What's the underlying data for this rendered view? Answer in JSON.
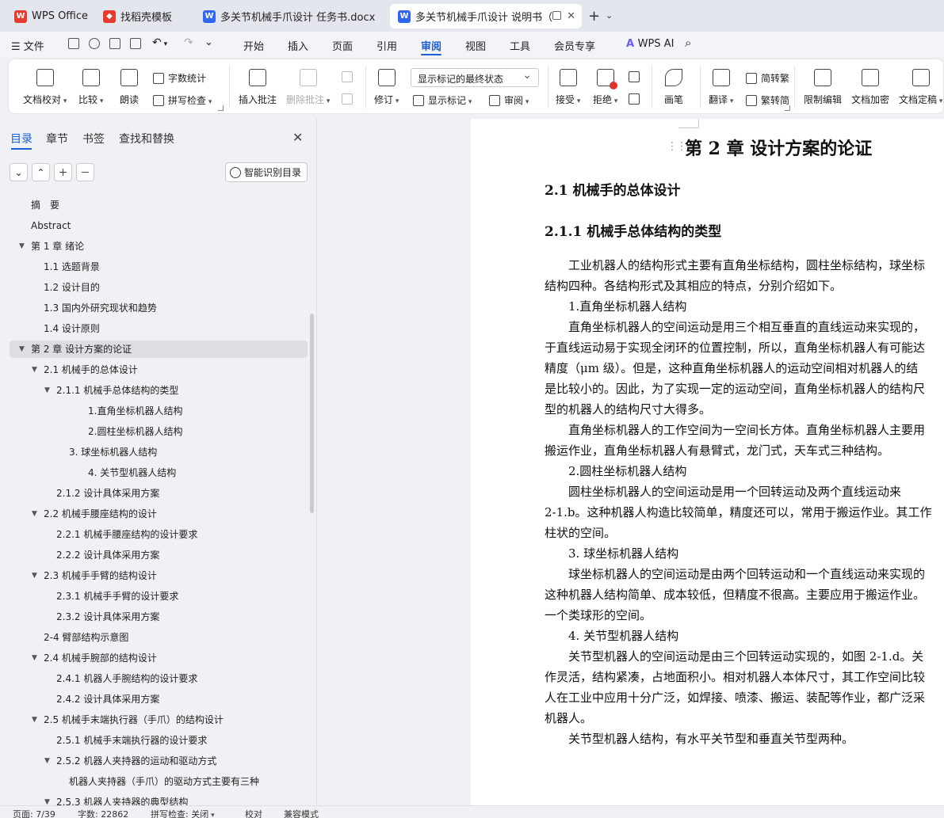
{
  "tabs": [
    {
      "label": "WPS Office",
      "icon": "wps-logo-icon",
      "color": "#e63a2e"
    },
    {
      "label": "找稻壳模板",
      "icon": "docer-icon",
      "color": "#e63a2e"
    },
    {
      "label": "多关节机械手爪设计 任务书.docx",
      "icon": "word-doc-icon",
      "color": "#2f67f2"
    },
    {
      "label": "多关节机械手爪设计 说明书（",
      "icon": "word-doc-icon",
      "color": "#2f67f2"
    }
  ],
  "menu": {
    "file": "文件",
    "items": [
      "开始",
      "插入",
      "页面",
      "引用",
      "审阅",
      "视图",
      "工具",
      "会员专享"
    ],
    "active": "审阅",
    "ai": "WPS AI"
  },
  "ribbon": {
    "doc_check": "文档校对",
    "compare": "比较",
    "read_aloud": "朗读",
    "word_count": "字数统计",
    "spell_check": "拼写检查",
    "insert_comment": "插入批注",
    "delete_comment": "删除批注",
    "track": "修订",
    "markup_state": "显示标记的最终状态",
    "show_markup": "显示标记",
    "review_pane": "审阅",
    "accept": "接受",
    "reject": "拒绝",
    "pen": "画笔",
    "translate": "翻译",
    "to_traditional": "简转繁",
    "to_simplified": "繁转简",
    "restrict": "限制编辑",
    "encrypt": "文档加密",
    "finalize": "文档定稿"
  },
  "nav": {
    "tabs": [
      "目录",
      "章节",
      "书签",
      "查找和替换"
    ],
    "smart": "智能识别目录",
    "toc": [
      {
        "text": "摘　要",
        "level": 0,
        "arrow": false
      },
      {
        "text": "Abstract",
        "level": 0,
        "arrow": false
      },
      {
        "text": "第 1 章  绪论",
        "level": 0,
        "arrow": true
      },
      {
        "text": "1.1  选题背景",
        "level": 1,
        "arrow": false
      },
      {
        "text": "1.2  设计目的",
        "level": 1,
        "arrow": false
      },
      {
        "text": "1.3  国内外研究现状和趋势",
        "level": 1,
        "arrow": false
      },
      {
        "text": "1.4  设计原则",
        "level": 1,
        "arrow": false
      },
      {
        "text": "第 2 章  设计方案的论证",
        "level": 0,
        "arrow": true,
        "selected": true
      },
      {
        "text": "2.1 机械手的总体设计",
        "level": 1,
        "arrow": true
      },
      {
        "text": "2.1.1  机械手总体结构的类型",
        "level": 2,
        "arrow": true
      },
      {
        "text": "1.直角坐标机器人结构",
        "level": 4,
        "arrow": false
      },
      {
        "text": "2.圆柱坐标机器人结构",
        "level": 4,
        "arrow": false
      },
      {
        "text": "3.  球坐标机器人结构",
        "level": 3,
        "arrow": false
      },
      {
        "text": "4.  关节型机器人结构",
        "level": 4,
        "arrow": false
      },
      {
        "text": "2.1.2  设计具体采用方案",
        "level": 2,
        "arrow": false
      },
      {
        "text": "2.2  机械手腰座结构的设计",
        "level": 1,
        "arrow": true
      },
      {
        "text": "2.2.1  机械手腰座结构的设计要求",
        "level": 2,
        "arrow": false
      },
      {
        "text": "2.2.2  设计具体采用方案",
        "level": 2,
        "arrow": false
      },
      {
        "text": "2.3  机械手手臂的结构设计",
        "level": 1,
        "arrow": true
      },
      {
        "text": "2.3.1  机械手手臂的设计要求",
        "level": 2,
        "arrow": false
      },
      {
        "text": "2.3.2  设计具体采用方案",
        "level": 2,
        "arrow": false
      },
      {
        "text": "2-4  臂部结构示意图",
        "level": 1,
        "arrow": false
      },
      {
        "text": "2.4  机械手腕部的结构设计",
        "level": 1,
        "arrow": true
      },
      {
        "text": "2.4.1  机器人手腕结构的设计要求",
        "level": 2,
        "arrow": false
      },
      {
        "text": "2.4.2 设计具体采用方案",
        "level": 2,
        "arrow": false
      },
      {
        "text": "2.5 机械手末端执行器（手爪）的结构设计",
        "level": 1,
        "arrow": true
      },
      {
        "text": "2.5.1 机械手末端执行器的设计要求",
        "level": 2,
        "arrow": false
      },
      {
        "text": "2.5.2 机器人夹持器的运动和驱动方式",
        "level": 2,
        "arrow": true
      },
      {
        "text": "机器人夹持器（手爪）的驱动方式主要有三种",
        "level": 3,
        "arrow": false
      },
      {
        "text": "2.5.3  机器人夹持器的典型结构",
        "level": 2,
        "arrow": true
      }
    ]
  },
  "doc": {
    "h1": "第 2 章  设计方案的论证",
    "h2": "2.1 机械手的总体设计",
    "h3": "2.1.1  机械手总体结构的类型",
    "lines": [
      "　　工业机器人的结构形式主要有直角坐标结构，圆柱坐标结构，球坐标",
      "结构四种。各结构形式及其相应的特点，分别介绍如下。",
      "　　1.直角坐标机器人结构",
      "　　直角坐标机器人的空间运动是用三个相互垂直的直线运动来实现的，",
      "于直线运动易于实现全闭环的位置控制，所以，直角坐标机器人有可能达",
      "精度（μm 级）。但是，这种直角坐标机器人的运动空间相对机器人的结",
      "是比较小的。因此，为了实现一定的运动空间，直角坐标机器人的结构尺",
      "型的机器人的结构尺寸大得多。",
      "　　直角坐标机器人的工作空间为一空间长方体。直角坐标机器人主要用",
      "搬运作业，直角坐标机器人有悬臂式，龙门式，天车式三种结构。",
      "　　2.圆柱坐标机器人结构",
      "　　圆柱坐标机器人的空间运动是用一个回转运动及两个直线运动来",
      "2-1.b。这种机器人构造比较简单，精度还可以，常用于搬运作业。其工作",
      "柱状的空间。",
      "　　3.  球坐标机器人结构",
      "　　球坐标机器人的空间运动是由两个回转运动和一个直线运动来实现的",
      "这种机器人结构简单、成本较低，但精度不很高。主要应用于搬运作业。",
      "一个类球形的空间。",
      "　　4.  关节型机器人结构",
      "　　关节型机器人的空间运动是由三个回转运动实现的，如图 2-1.d。关",
      "作灵活，结构紧凑，占地面积小。相对机器人本体尺寸，其工作空间比较",
      "人在工业中应用十分广泛，如焊接、喷漆、搬运、装配等作业，都广泛采",
      "机器人。",
      "　　关节型机器人结构，有水平关节型和垂直关节型两种。"
    ]
  },
  "status": {
    "page": "页面: 7/39",
    "words": "字数: 22862",
    "spell": "拼写检查: 关闭",
    "proof": "校对",
    "compat": "兼容模式"
  }
}
